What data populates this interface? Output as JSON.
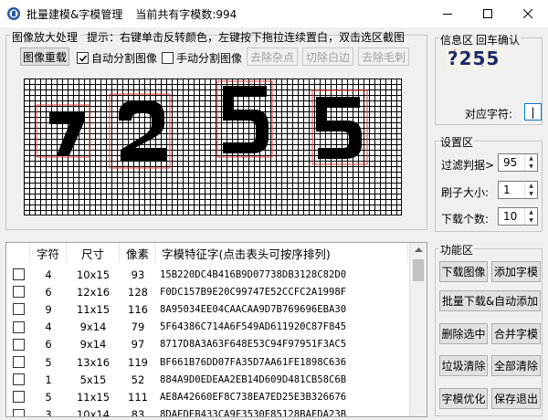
{
  "window": {
    "title": "批量建模&字模管理",
    "subtitle": "当前共有字模数:994"
  },
  "image_panel": {
    "label": "图像放大处理",
    "hint": "提示：右键单击反转颜色，左键按下拖拉连续置白，双击选区截图",
    "buttons": {
      "reload": "图像重载",
      "remove_noise": "去除杂点",
      "cut_edge": "切除白边",
      "remove_burr": "去除毛刺"
    },
    "auto_split": {
      "label": "自动分割图像",
      "checked": true
    },
    "manual_split": {
      "label": "手动分割图像",
      "checked": false
    }
  },
  "table": {
    "columns": [
      "字符",
      "尺寸",
      "像素",
      "字模特征字(点击表头可按序排列)"
    ],
    "rows": [
      {
        "char": "4",
        "size": "10x15",
        "pixels": "93",
        "feature": "15B220DC4B416B9D07738DB3128C82D0"
      },
      {
        "char": "6",
        "size": "12x16",
        "pixels": "128",
        "feature": "F0DC157B9E20C99747E52CCFC2A1998F"
      },
      {
        "char": "9",
        "size": "11x15",
        "pixels": "116",
        "feature": "8A95034EE04CAACAA9D7B769696EBA30"
      },
      {
        "char": "4",
        "size": "9x14",
        "pixels": "79",
        "feature": "5F64386C714A6F549AD611920C87F845"
      },
      {
        "char": "6",
        "size": "9x14",
        "pixels": "97",
        "feature": "8717D8A3A63F648E53C94F97951F3AC5"
      },
      {
        "char": "5",
        "size": "13x16",
        "pixels": "119",
        "feature": "BF661B76DD07FA35D7AA61FE1898C636"
      },
      {
        "char": "1",
        "size": "5x15",
        "pixels": "52",
        "feature": "884A9D0EDEAA2EB14D609D481CB58C6B"
      },
      {
        "char": "5",
        "size": "11x15",
        "pixels": "111",
        "feature": "AE8A42660EF8C738EA7ED25E3B326676"
      },
      {
        "char": "3",
        "size": "10x14",
        "pixels": "83",
        "feature": "8DAEDEB433CA9F3530E85128BAFDA23B"
      }
    ]
  },
  "info": {
    "label": "信息区",
    "confirm_label": "回车确认",
    "captcha_text": "?255",
    "char_label": "对应字符:",
    "char_value": "|"
  },
  "settings": {
    "label": "设置区",
    "filter": {
      "label": "过滤判据>",
      "value": "95"
    },
    "brush": {
      "label": "刷子大小:",
      "value": "1"
    },
    "download_count": {
      "label": "下载个数:",
      "value": "10"
    }
  },
  "functions": {
    "label": "功能区",
    "download_image": "下载图像",
    "add_font": "添加字模",
    "batch_download": "批量下载&自动添加",
    "delete_selected": "删除选中",
    "merge_fonts": "合并字模",
    "clean_garbage": "垃圾清除",
    "clear_all": "全部清除",
    "optimize": "字模优化",
    "save_exit": "保存退出"
  },
  "colors": {
    "accent": "#0078d7",
    "selection": "#ff0000",
    "pixel": "#000000"
  }
}
